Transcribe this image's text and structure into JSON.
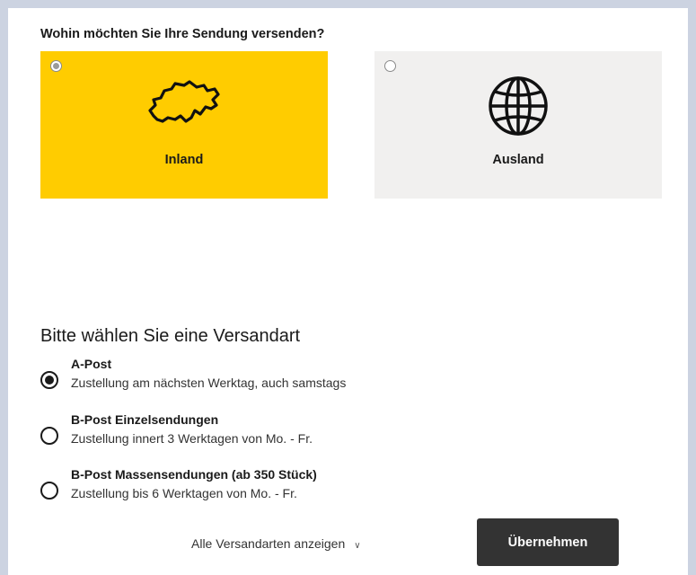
{
  "question": "Wohin möchten Sie Ihre Sendung versenden?",
  "destinations": [
    {
      "label": "Inland",
      "icon": "switzerland-map-icon",
      "selected": true,
      "color": "#ffcc00"
    },
    {
      "label": "Ausland",
      "icon": "globe-icon",
      "selected": false,
      "color": "#f1f0ef"
    }
  ],
  "shipping": {
    "title": "Bitte wählen Sie eine Versandart",
    "options": [
      {
        "title": "A-Post",
        "description": "Zustellung am nächsten Werktag, auch samstags",
        "selected": true
      },
      {
        "title": "B-Post Einzelsendungen",
        "description": "Zustellung innert 3 Werktagen von Mo. - Fr.",
        "selected": false
      },
      {
        "title": "B-Post Massensendungen (ab 350 Stück)",
        "description": "Zustellung bis 6 Werktagen von Mo. - Fr.",
        "selected": false
      }
    ]
  },
  "actions": {
    "show_all": "Alle Versandarten anzeigen",
    "show_all_icon": "chevron-down-icon",
    "submit": "Übernehmen"
  }
}
